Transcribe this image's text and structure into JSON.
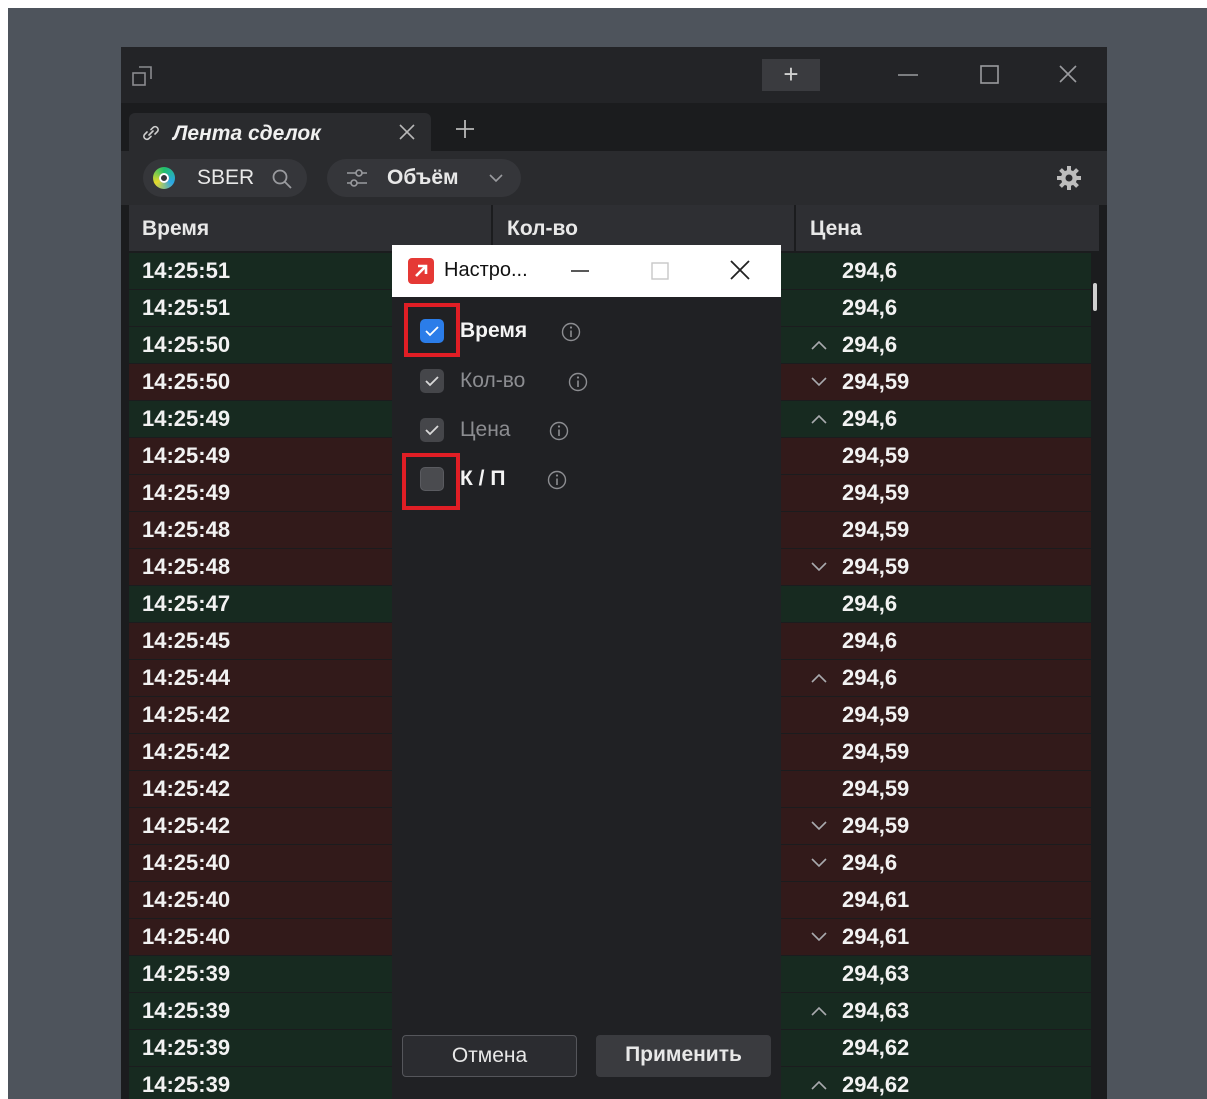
{
  "tab": {
    "title": "Лента сделок"
  },
  "toolbar": {
    "ticker": "SBER",
    "volume_label": "Объём"
  },
  "columns": [
    "Время",
    "Кол-во",
    "Цена"
  ],
  "trades": [
    {
      "time": "14:25:51",
      "price": "294,6",
      "side": "buy",
      "dir": ""
    },
    {
      "time": "14:25:51",
      "price": "294,6",
      "side": "buy",
      "dir": ""
    },
    {
      "time": "14:25:50",
      "price": "294,6",
      "side": "buy",
      "dir": "up"
    },
    {
      "time": "14:25:50",
      "price": "294,59",
      "side": "sell",
      "dir": "down"
    },
    {
      "time": "14:25:49",
      "price": "294,6",
      "side": "buy",
      "dir": "up"
    },
    {
      "time": "14:25:49",
      "price": "294,59",
      "side": "sell",
      "dir": ""
    },
    {
      "time": "14:25:49",
      "price": "294,59",
      "side": "sell",
      "dir": ""
    },
    {
      "time": "14:25:48",
      "price": "294,59",
      "side": "sell",
      "dir": ""
    },
    {
      "time": "14:25:48",
      "price": "294,59",
      "side": "sell",
      "dir": "down"
    },
    {
      "time": "14:25:47",
      "price": "294,6",
      "side": "buy",
      "dir": ""
    },
    {
      "time": "14:25:45",
      "price": "294,6",
      "side": "sell",
      "dir": ""
    },
    {
      "time": "14:25:44",
      "price": "294,6",
      "side": "sell",
      "dir": "up"
    },
    {
      "time": "14:25:42",
      "price": "294,59",
      "side": "sell",
      "dir": ""
    },
    {
      "time": "14:25:42",
      "price": "294,59",
      "side": "sell",
      "dir": ""
    },
    {
      "time": "14:25:42",
      "price": "294,59",
      "side": "sell",
      "dir": ""
    },
    {
      "time": "14:25:42",
      "price": "294,59",
      "side": "sell",
      "dir": "down"
    },
    {
      "time": "14:25:40",
      "price": "294,6",
      "side": "sell",
      "dir": "down"
    },
    {
      "time": "14:25:40",
      "price": "294,61",
      "side": "sell",
      "dir": ""
    },
    {
      "time": "14:25:40",
      "price": "294,61",
      "side": "sell",
      "dir": "down"
    },
    {
      "time": "14:25:39",
      "price": "294,63",
      "side": "buy",
      "dir": ""
    },
    {
      "time": "14:25:39",
      "price": "294,63",
      "side": "buy",
      "dir": "up"
    },
    {
      "time": "14:25:39",
      "price": "294,62",
      "side": "buy",
      "dir": ""
    },
    {
      "time": "14:25:39",
      "price": "294,62",
      "side": "buy",
      "dir": "up"
    }
  ],
  "dialog": {
    "title": "Настро...",
    "options": [
      {
        "label": "Время",
        "checked": true,
        "enabled": true
      },
      {
        "label": "Кол-во",
        "checked": true,
        "enabled": false
      },
      {
        "label": "Цена",
        "checked": true,
        "enabled": false
      },
      {
        "label": "К / П",
        "checked": false,
        "enabled": true
      }
    ],
    "cancel_label": "Отмена",
    "apply_label": "Применить"
  }
}
